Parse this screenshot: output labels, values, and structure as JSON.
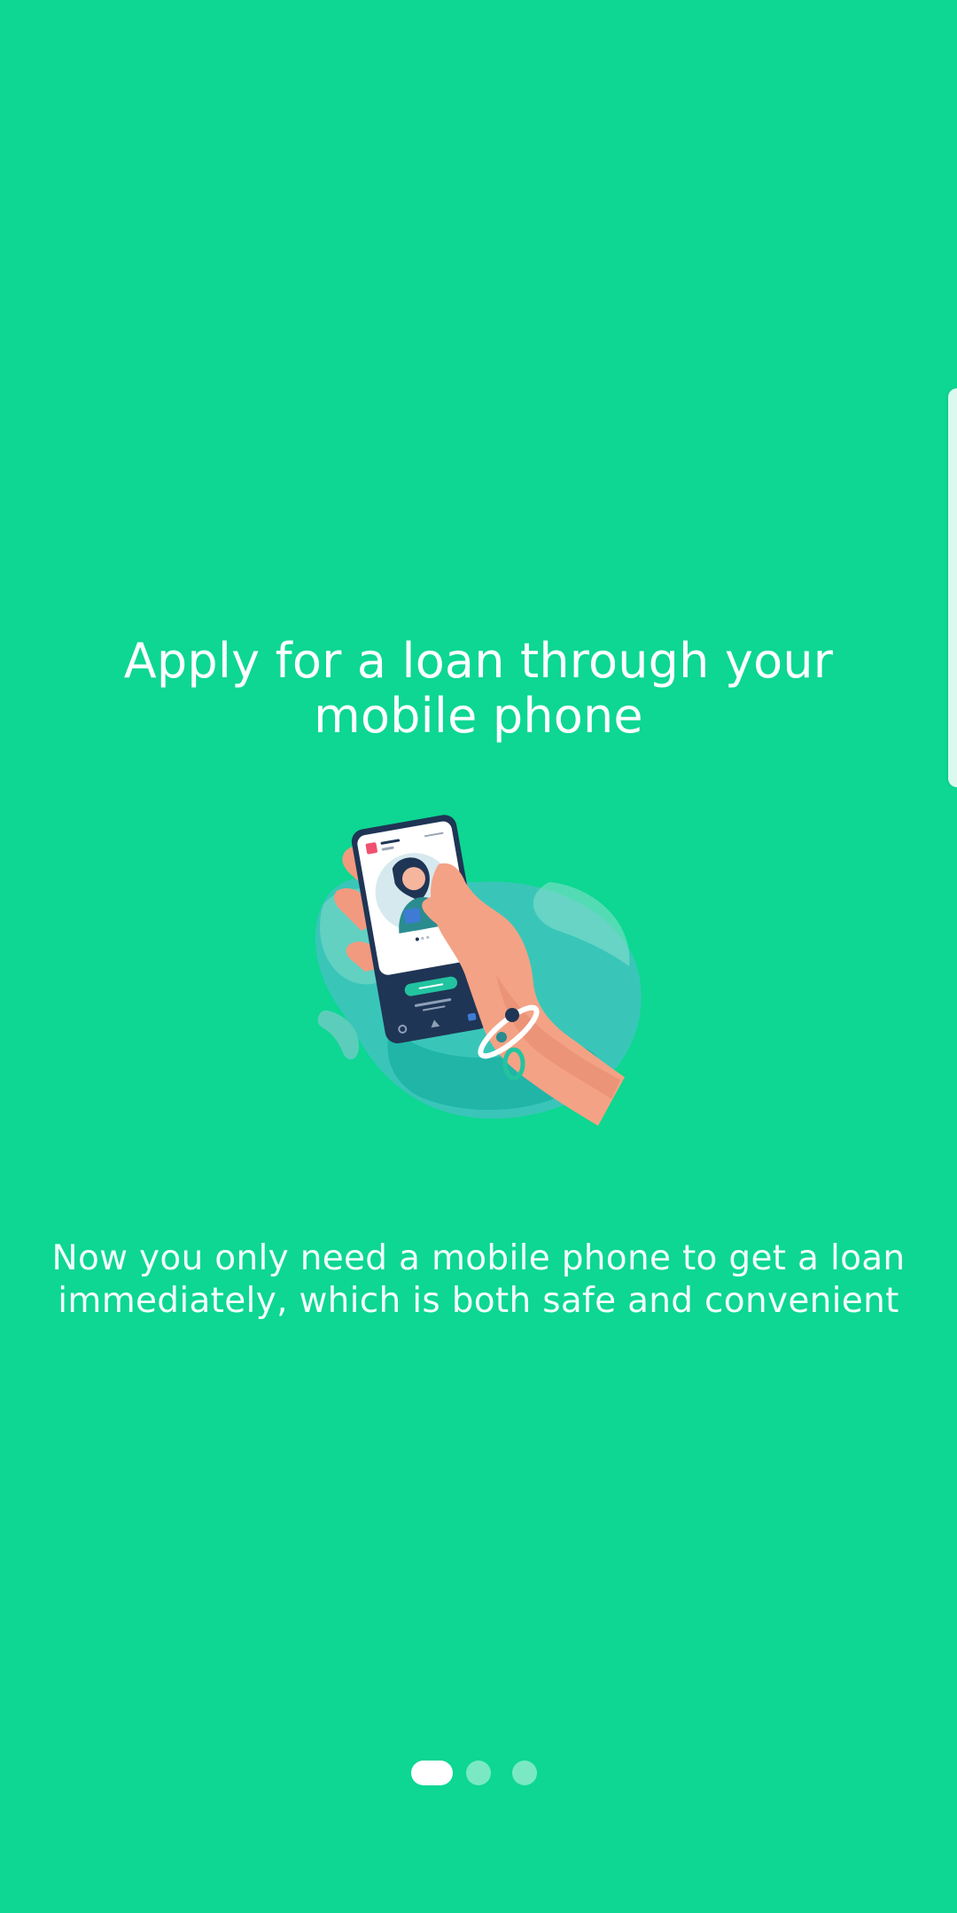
{
  "onboarding": {
    "title": "Apply for a loan through your mobile phone",
    "subtitle": "Now you only need a mobile phone to get a loan immediately, which is both safe and convenient",
    "current_page": 1,
    "total_pages": 3
  },
  "colors": {
    "background": "#0dd792",
    "text": "#ffffff",
    "dot_active": "#ffffff",
    "dot_inactive": "rgba(255,255,255,0.45)"
  },
  "icons": {
    "illustration": "hand-holding-phone-illustration",
    "edge_panel": "edge-panel-handle"
  }
}
